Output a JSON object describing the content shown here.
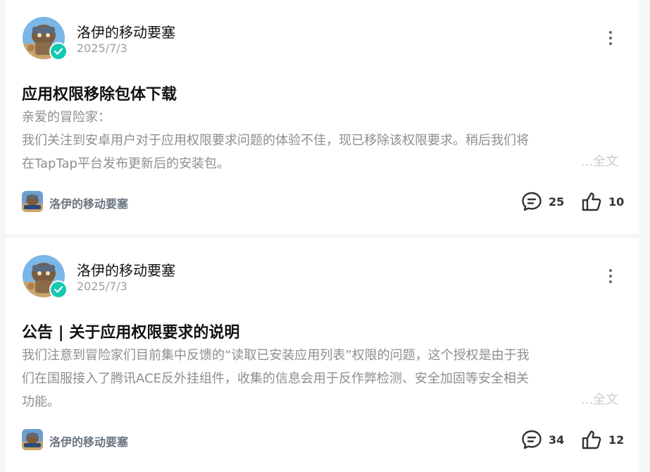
{
  "posts": [
    {
      "author": "洛伊的移动要塞",
      "date": "2025/7/3",
      "title": "应用权限移除包体下载",
      "body_lines": [
        "亲爱的冒险家：",
        "我们关注到安卓用户对于应用权限要求问题的体验不佳，现已移除该权限要求。稍后我们将",
        "在TapTap平台发布更新后的安装包。"
      ],
      "read_more": "...全文",
      "footer_author": "洛伊的移动要塞",
      "comments": "25",
      "likes": "10"
    },
    {
      "author": "洛伊的移动要塞",
      "date": "2025/7/3",
      "title": "公告 | 关于应用权限要求的说明",
      "body_lines": [
        "我们注意到冒险家们目前集中反馈的“读取已安装应用列表”权限的问题，这个授权是由于我",
        "们在国服接入了腾讯ACE反外挂组件，收集的信息会用于反作弊检测、安全加固等安全相关",
        "功能。"
      ],
      "read_more": "...全文",
      "footer_author": "洛伊的移动要塞",
      "comments": "34",
      "likes": "12"
    }
  ],
  "icons": {
    "avatar": "avatar-image",
    "verified": "verified-check-icon",
    "more": "more-vertical-icon",
    "comment": "comment-bubble-icon",
    "like": "thumbs-up-icon"
  },
  "colors": {
    "verified": "#14c9b2",
    "muted_text": "#8e8e8e",
    "footer_name": "#6b7680"
  }
}
